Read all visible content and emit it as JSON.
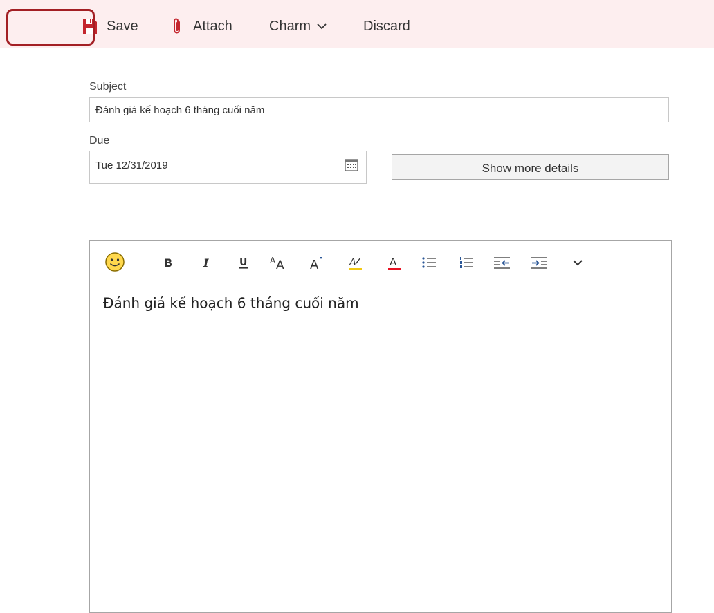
{
  "toolbar": {
    "save_label": "Save",
    "attach_label": "Attach",
    "charm_label": "Charm",
    "discard_label": "Discard"
  },
  "form": {
    "subject_label": "Subject",
    "subject_value": "Đánh giá kế hoạch 6 tháng cuối năm",
    "due_label": "Due",
    "due_value": "Tue 12/31/2019",
    "details_button_label": "Show more details"
  },
  "editor": {
    "formatting_icons": [
      "emoji-icon",
      "bold-icon",
      "italic-icon",
      "underline-icon",
      "font-size-icon",
      "superscript-icon",
      "highlight-icon",
      "font-color-icon",
      "bullets-icon",
      "numbering-icon",
      "decrease-indent-icon",
      "increase-indent-icon",
      "more-options-icon"
    ],
    "body_text": "Đánh giá kế hoạch 6 tháng cuối năm"
  },
  "colors": {
    "toolbar_bg": "#fdeeef",
    "accent_red": "#c4262e",
    "highlight_box": "#a31f24",
    "indent_blue": "#2b5797",
    "highlight_yellow": "#f2c811",
    "font_color_red": "#e81123"
  }
}
